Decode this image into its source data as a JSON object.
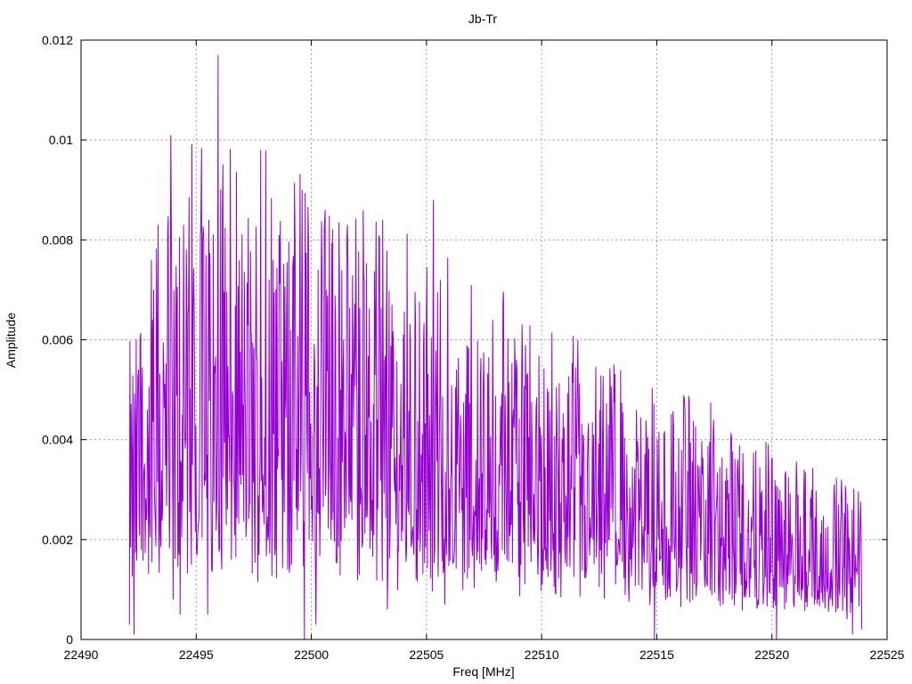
{
  "chart_data": {
    "type": "line",
    "title": "Jb-Tr",
    "xlabel": "Freq [MHz]",
    "ylabel": "Amplitude",
    "xlim": [
      22490,
      22525
    ],
    "ylim": [
      0,
      0.012
    ],
    "x_ticks": [
      22490,
      22495,
      22500,
      22505,
      22510,
      22515,
      22520,
      22525
    ],
    "x_tick_labels": [
      "22490",
      "22495",
      "22500",
      "22505",
      "22510",
      "22515",
      "22520",
      "22525"
    ],
    "y_ticks": [
      0,
      0.002,
      0.004,
      0.006,
      0.008,
      0.01,
      0.012
    ],
    "y_tick_labels": [
      "0",
      "0.002",
      "0.004",
      "0.006",
      "0.008",
      "0.01",
      "0.012"
    ],
    "grid": true,
    "legend": false,
    "series": [
      {
        "color": "#9400d3",
        "x_start": 22492.1,
        "x_end": 22523.9,
        "peaks": [
          {
            "x": 22492.2,
            "y": 0.0037
          },
          {
            "x": 22492.5,
            "y": 0.0054
          },
          {
            "x": 22493.1,
            "y": 0.0064
          },
          {
            "x": 22493.35,
            "y": 0.0083
          },
          {
            "x": 22493.9,
            "y": 0.0101
          },
          {
            "x": 22494.3,
            "y": 0.0108
          },
          {
            "x": 22494.45,
            "y": 0.0083
          },
          {
            "x": 22495.2,
            "y": 0.0082
          },
          {
            "x": 22495.55,
            "y": 0.0084
          },
          {
            "x": 22495.95,
            "y": 0.0117
          },
          {
            "x": 22496.5,
            "y": 0.0069
          },
          {
            "x": 22497.4,
            "y": 0.0061
          },
          {
            "x": 22497.8,
            "y": 0.0098
          },
          {
            "x": 22498.6,
            "y": 0.0081
          },
          {
            "x": 22499.1,
            "y": 0.0062
          },
          {
            "x": 22499.6,
            "y": 0.009
          },
          {
            "x": 22500.6,
            "y": 0.0086
          },
          {
            "x": 22501.4,
            "y": 0.006
          },
          {
            "x": 22502.3,
            "y": 0.0072
          },
          {
            "x": 22503.1,
            "y": 0.0084
          },
          {
            "x": 22503.5,
            "y": 0.0067
          },
          {
            "x": 22504.0,
            "y": 0.0061
          },
          {
            "x": 22505.3,
            "y": 0.0088
          },
          {
            "x": 22505.6,
            "y": 0.0072
          },
          {
            "x": 22506.3,
            "y": 0.0054
          },
          {
            "x": 22508.2,
            "y": 0.004
          },
          {
            "x": 22508.9,
            "y": 0.0056
          },
          {
            "x": 22509.3,
            "y": 0.0059
          },
          {
            "x": 22510.0,
            "y": 0.0041
          },
          {
            "x": 22511.8,
            "y": 0.0041
          },
          {
            "x": 22512.9,
            "y": 0.0043
          },
          {
            "x": 22514.2,
            "y": 0.0036
          },
          {
            "x": 22516.2,
            "y": 0.0048
          },
          {
            "x": 22518.7,
            "y": 0.0031
          },
          {
            "x": 22520.3,
            "y": 0.0028
          },
          {
            "x": 22522.7,
            "y": 0.0031
          },
          {
            "x": 22523.5,
            "y": 0.0016
          }
        ],
        "troughs": [
          {
            "x": 22492.1,
            "y": 0.0003
          },
          {
            "x": 22492.3,
            "y": 0.0001
          },
          {
            "x": 22494.0,
            "y": 0.0008
          },
          {
            "x": 22494.3,
            "y": 0.0005
          },
          {
            "x": 22495.5,
            "y": 0.0005
          },
          {
            "x": 22499.7,
            "y": 0.0
          },
          {
            "x": 22500.2,
            "y": 0.0003
          },
          {
            "x": 22503.3,
            "y": 0.0006
          },
          {
            "x": 22505.8,
            "y": 0.0007
          },
          {
            "x": 22514.9,
            "y": 0.0
          },
          {
            "x": 22520.2,
            "y": 0.0
          },
          {
            "x": 22523.5,
            "y": 0.0001
          },
          {
            "x": 22523.9,
            "y": 0.0002
          }
        ]
      }
    ]
  }
}
